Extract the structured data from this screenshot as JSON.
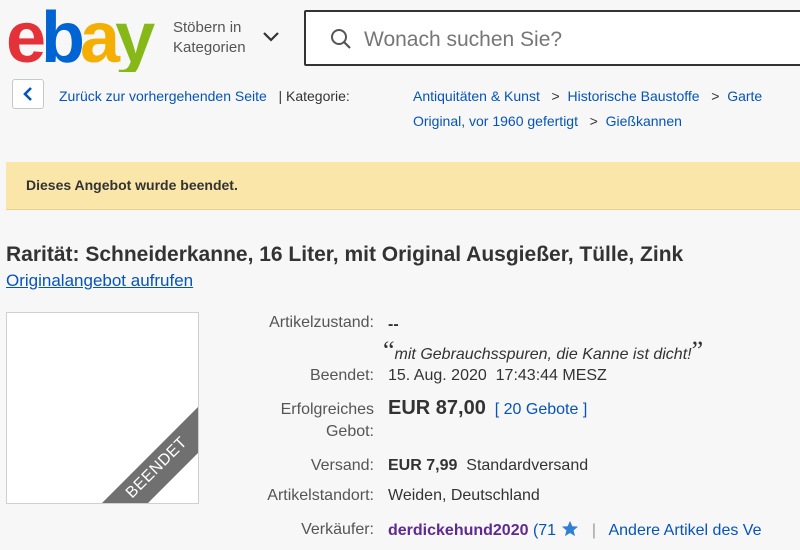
{
  "header": {
    "logo_letters": [
      "e",
      "b",
      "a",
      "y"
    ],
    "logo_colors": [
      "#e53238",
      "#0064d2",
      "#f5af02",
      "#86b817"
    ],
    "browse_line1": "Stöbern in",
    "browse_line2": "Kategorien",
    "browse_icon": "chevron-down-icon",
    "search_placeholder": "Wonach suchen Sie?",
    "search_icon": "search-icon"
  },
  "breadcrumb": {
    "back_icon": "chevron-left-icon",
    "back_label": "Zurück zur vorhergehenden Seite",
    "divider": "|",
    "category_label": "Kategorie:",
    "separator": ">",
    "items": [
      "Antiquitäten & Kunst",
      "Historische Baustoffe",
      "Garte",
      "Original, vor 1960 gefertigt",
      "Gießkannen"
    ]
  },
  "banner": {
    "message": "Dieses Angebot wurde beendet.",
    "color": "#f9e6a8"
  },
  "listing": {
    "title": "Rarität: Schneiderkanne, 16 Liter, mit Original Ausgießer, Tülle, Zink",
    "original_link": "Originalangebot aufrufen",
    "image_ribbon": "BEENDET",
    "condition_label": "Artikelzustand:",
    "condition_value": "--",
    "seller_note": "mit Gebrauchsspuren, die Kanne ist dicht!",
    "quote_open": "“",
    "quote_close": "”",
    "ended_label": "Beendet:",
    "ended_date": "15. Aug. 2020",
    "ended_time": "17:43:44 MESZ",
    "bid_label_1": "Erfolgreiches",
    "bid_label_2": "Gebot:",
    "price": "EUR 87,00",
    "bids_open": "[",
    "bids_count": "20 Gebote",
    "bids_close": "]",
    "shipping_label": "Versand:",
    "shipping_price": "EUR 7,99",
    "shipping_type": "Standardversand",
    "location_label": "Artikelstandort:",
    "location_value": "Weiden, Deutschland",
    "seller_label": "Verkäufer:",
    "seller_name": "derdickehund2020",
    "feedback_open": "(",
    "feedback_score": "71",
    "feedback_icon": "star-icon",
    "seller_divider": "|",
    "other_items": "Andere Artikel des Ve"
  }
}
